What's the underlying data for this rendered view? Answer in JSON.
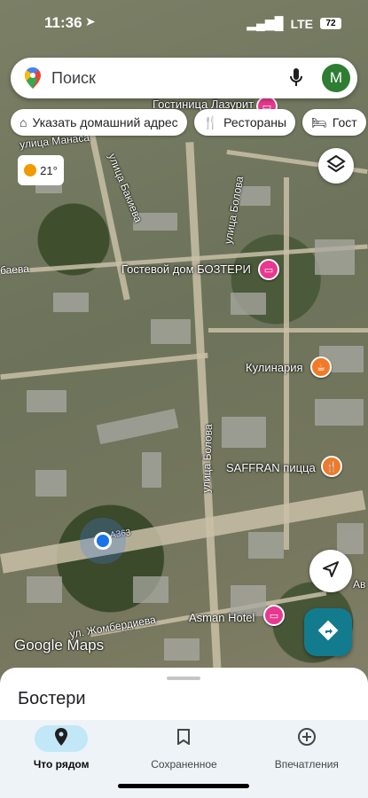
{
  "status_bar": {
    "time": "11:36",
    "network": "LTE",
    "battery": "72"
  },
  "search": {
    "placeholder": "Поиск",
    "avatar_letter": "M"
  },
  "chips": [
    {
      "icon": "home-icon",
      "label": "Указать домашний адрес"
    },
    {
      "icon": "restaurant-icon",
      "label": "Рестораны"
    },
    {
      "icon": "hotel-icon",
      "label": "Гост"
    }
  ],
  "weather": {
    "temperature": "21°"
  },
  "map": {
    "streets": {
      "manasa": "улица Манаса",
      "bakieva": "улица Бакиева",
      "bolotova_north": "улица Болова",
      "bolotova_south": "улица Болова",
      "baeva": "баева",
      "jomberdieva": "ул. Жомбердиева",
      "route": "А363",
      "av": "Ав"
    },
    "pois": {
      "lazurit": "Гостиница Лазурит",
      "bozteri": "Гостевой дом БОЗТЕРИ",
      "kulinaria": "Кулинария",
      "saffran": "SAFFRAN пицца",
      "asman": "Asman Hotel"
    },
    "logo": "Google Maps",
    "colors": {
      "hotel_pin": "#e8388f",
      "food_pin": "#f07a27",
      "location_dot": "#1a73e8"
    }
  },
  "sheet": {
    "title": "Бостери"
  },
  "bottom_nav": [
    {
      "icon": "location-pin-icon",
      "label": "Что рядом",
      "active": true
    },
    {
      "icon": "bookmark-icon",
      "label": "Сохраненное",
      "active": false
    },
    {
      "icon": "add-circle-icon",
      "label": "Впечатления",
      "active": false
    }
  ]
}
